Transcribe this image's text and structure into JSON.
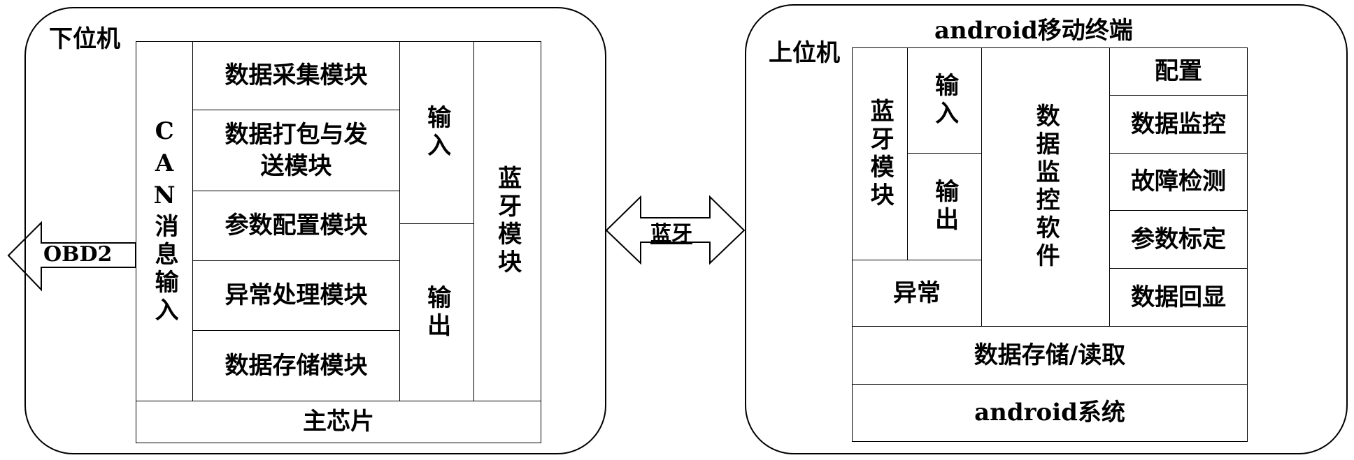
{
  "lower_machine": {
    "label": "下位机",
    "can_input": "CAN消息输入",
    "modules": [
      "数据采集模块",
      "数据打包与发送模块",
      "参数配置模块",
      "异常处理模块",
      "数据存储模块"
    ],
    "module_2_line1": "数据打包与发",
    "module_2_line2": "送模块",
    "input": "输入",
    "output": "输出",
    "bluetooth_module": "蓝牙模块",
    "main_chip": "主芯片",
    "obd_arrow": "OBD2"
  },
  "link": {
    "label": "蓝牙"
  },
  "upper_machine": {
    "title": "android移动终端",
    "label": "上位机",
    "bluetooth_module": "蓝牙模块",
    "input": "输入",
    "output": "输出",
    "software": "数据监控软件",
    "functions": [
      "配置",
      "数据监控",
      "故障检测",
      "参数标定",
      "数据回显"
    ],
    "exception": "异常",
    "storage": "数据存储/读取",
    "system": "android系统"
  }
}
